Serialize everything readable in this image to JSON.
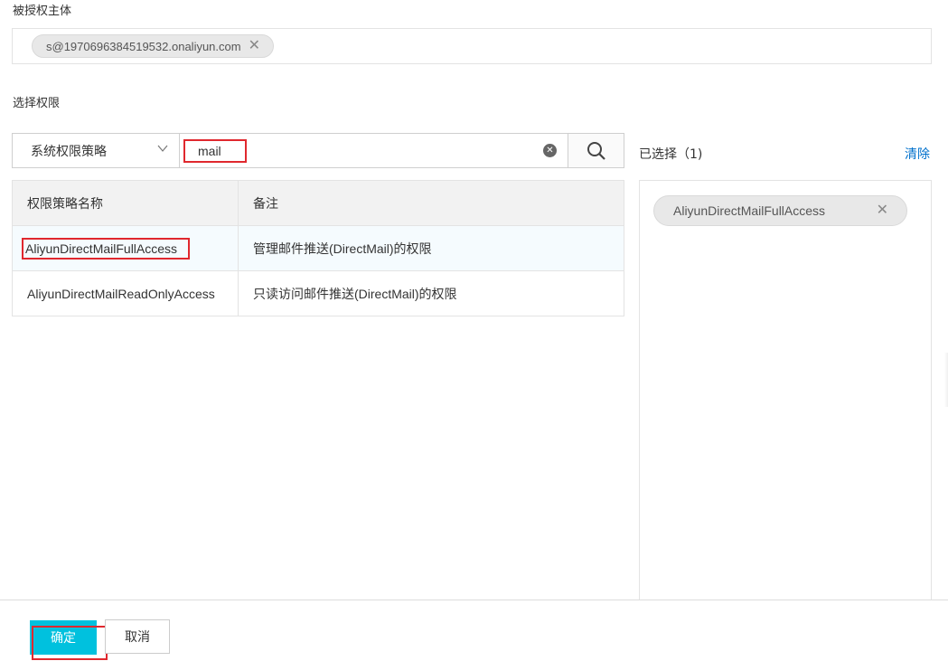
{
  "grantee": {
    "label": "被授权主体",
    "tag": "s@1970696384519532.onaliyun.com"
  },
  "permissions": {
    "label": "选择权限",
    "policy_type": "系统权限策略",
    "search_value": "mail",
    "table": {
      "headers": [
        "权限策略名称",
        "备注"
      ],
      "rows": [
        {
          "name": "AliyunDirectMailFullAccess",
          "note": "管理邮件推送(DirectMail)的权限"
        },
        {
          "name": "AliyunDirectMailReadOnlyAccess",
          "note": "只读访问邮件推送(DirectMail)的权限"
        }
      ]
    }
  },
  "selected": {
    "title": "已选择（1)",
    "clear_label": "清除",
    "items": [
      "AliyunDirectMailFullAccess"
    ]
  },
  "footer": {
    "ok_label": "确定",
    "cancel_label": "取消"
  },
  "colors": {
    "primary": "#00c1de",
    "link": "#0070cc",
    "highlight": "#e0282e"
  }
}
